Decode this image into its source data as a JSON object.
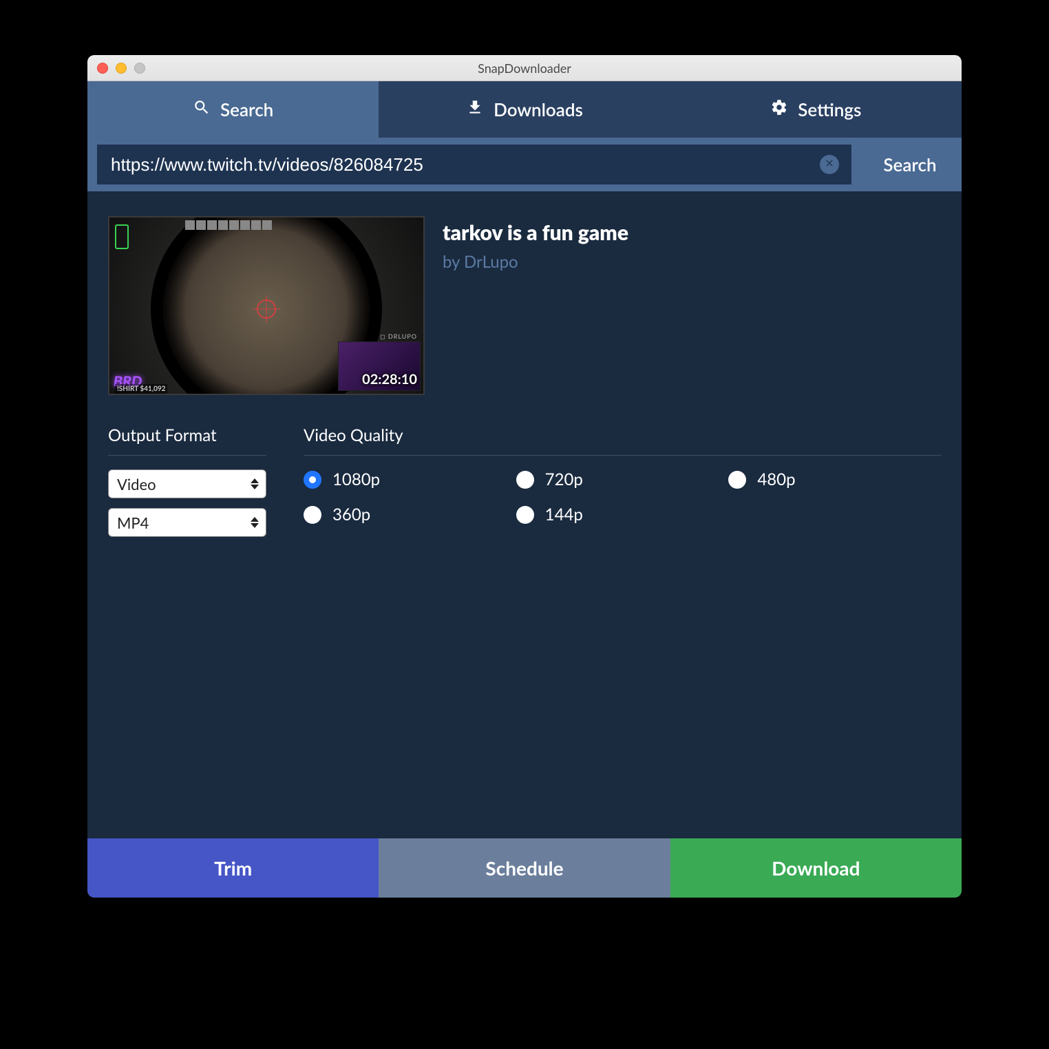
{
  "window": {
    "title": "SnapDownloader"
  },
  "tabs": {
    "search": "Search",
    "downloads": "Downloads",
    "settings": "Settings",
    "active": "search"
  },
  "search": {
    "url": "https://www.twitch.tv/videos/826084725",
    "button": "Search"
  },
  "video": {
    "title": "tarkov is a fun game",
    "author": "by DrLupo",
    "duration": "02:28:10",
    "webcam_label": "◻ DRLUPO",
    "brb": "BRD",
    "ishirt": "!SHIRT  $41,092"
  },
  "output": {
    "heading": "Output Format",
    "type": "Video",
    "format": "MP4"
  },
  "quality": {
    "heading": "Video Quality",
    "options": [
      "1080p",
      "720p",
      "480p",
      "360p",
      "144p"
    ],
    "selected": "1080p"
  },
  "footer": {
    "trim": "Trim",
    "schedule": "Schedule",
    "download": "Download"
  }
}
